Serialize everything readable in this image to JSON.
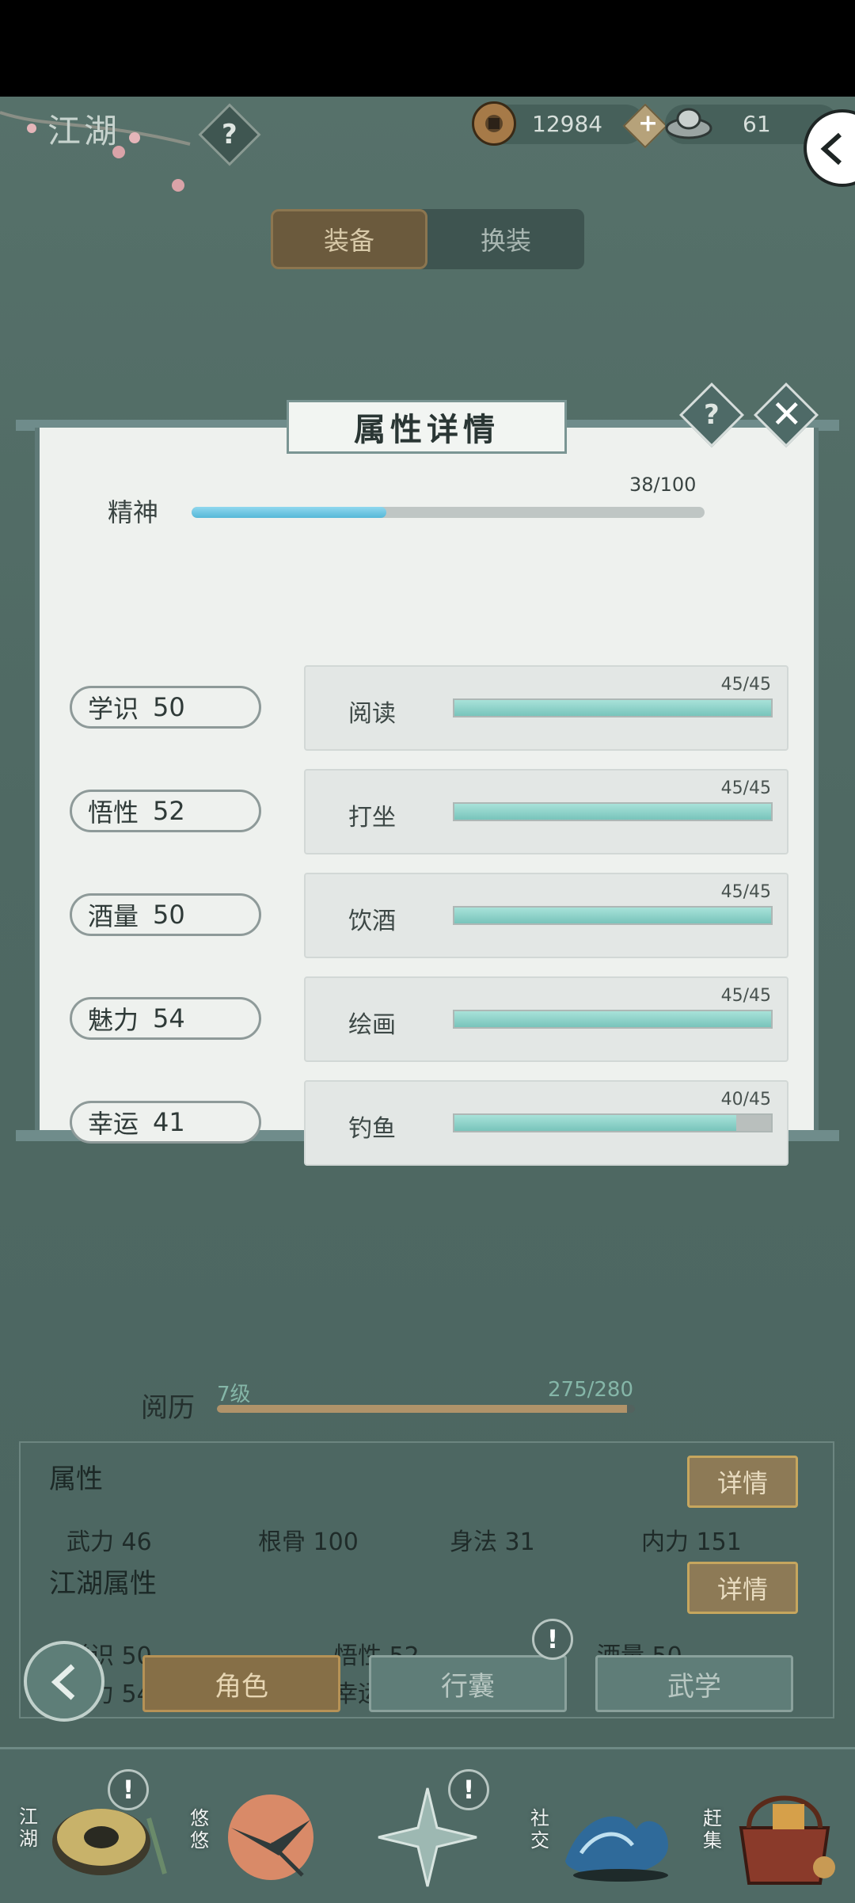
{
  "header": {
    "title": "江湖",
    "help": "?",
    "copper": "12984",
    "silver": "61",
    "plus": "+"
  },
  "tabs": [
    {
      "label": "装备"
    },
    {
      "label": "换装"
    }
  ],
  "modal": {
    "title": "属性详情",
    "help": "?",
    "close": "✕",
    "spirit": {
      "label": "精神",
      "value": "38/100",
      "fraction": 0.38
    },
    "stats": [
      {
        "name": "学识",
        "value": "50",
        "activity": "阅读",
        "progress": "45/45",
        "fraction": 1.0
      },
      {
        "name": "悟性",
        "value": "52",
        "activity": "打坐",
        "progress": "45/45",
        "fraction": 1.0
      },
      {
        "name": "酒量",
        "value": "50",
        "activity": "饮酒",
        "progress": "45/45",
        "fraction": 1.0
      },
      {
        "name": "魅力",
        "value": "54",
        "activity": "绘画",
        "progress": "45/45",
        "fraction": 1.0
      },
      {
        "name": "幸运",
        "value": "41",
        "activity": "钓鱼",
        "progress": "40/45",
        "fraction": 0.889
      }
    ]
  },
  "experience": {
    "label": "阅历",
    "level": "7级",
    "value": "275/280",
    "fraction": 0.982
  },
  "attributes": {
    "title": "属性",
    "detail": "详情",
    "items": [
      {
        "text": "武力  46"
      },
      {
        "text": "根骨  100"
      },
      {
        "text": "身法  31"
      },
      {
        "text": "内力  151"
      }
    ]
  },
  "jianghu_attributes": {
    "title": "江湖属性",
    "detail": "详情",
    "items": [
      {
        "text": "学识  50"
      },
      {
        "text": "悟性  52"
      },
      {
        "text": "酒量  50"
      },
      {
        "text": "魅力  54"
      },
      {
        "text": "幸运  41"
      }
    ]
  },
  "menu": {
    "role": "角色",
    "bag": "行囊",
    "martial": "武学",
    "alert": "!"
  },
  "bottom_nav": [
    {
      "label": "江湖"
    },
    {
      "label": "悠悠"
    },
    {
      "label": "社交"
    },
    {
      "label": "赶集"
    }
  ],
  "colors": {
    "accent_gold": "#866f47",
    "teal_bar": "#78c4bb",
    "spirit_bar": "#56b8d8",
    "panel_bg": "#eef1ee"
  }
}
